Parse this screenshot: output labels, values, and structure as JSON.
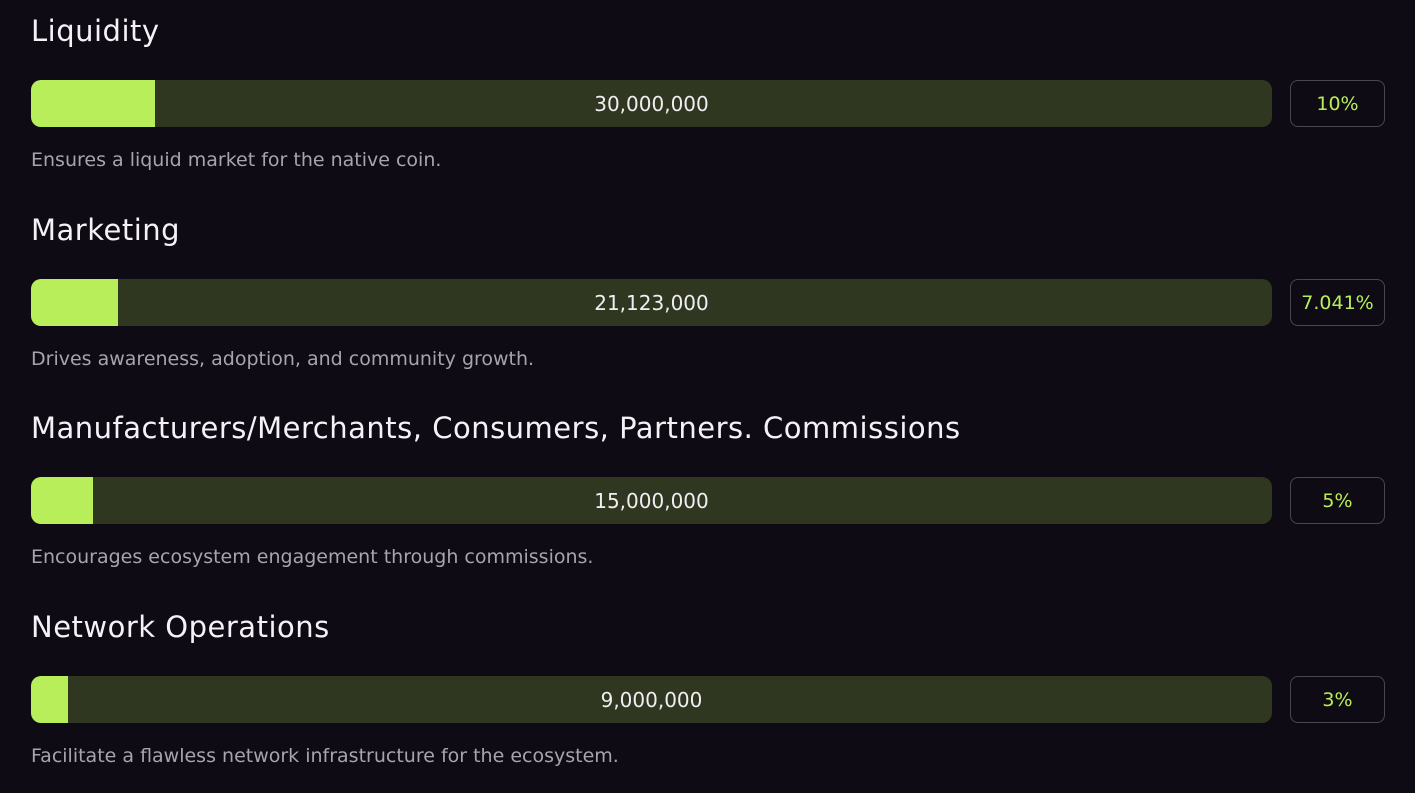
{
  "allocations": [
    {
      "title": "Liquidity",
      "amount": "30,000,000",
      "percent_label": "10%",
      "fill_fraction": 0.1,
      "description": "Ensures a liquid market for the native coin."
    },
    {
      "title": "Marketing",
      "amount": "21,123,000",
      "percent_label": "7.041%",
      "fill_fraction": 0.07041,
      "description": "Drives awareness, adoption, and community growth."
    },
    {
      "title": "Manufacturers/Merchants, Consumers, Partners. Commissions",
      "amount": "15,000,000",
      "percent_label": "5%",
      "fill_fraction": 0.05,
      "description": "Encourages ecosystem engagement through commissions."
    },
    {
      "title": "Network Operations",
      "amount": "9,000,000",
      "percent_label": "3%",
      "fill_fraction": 0.03,
      "description": "Facilitate a flawless network infrastructure for the ecosystem."
    }
  ],
  "colors": {
    "accent": "#b8ee5a",
    "bar_track": "#2f3720",
    "background": "#0f0b14"
  }
}
